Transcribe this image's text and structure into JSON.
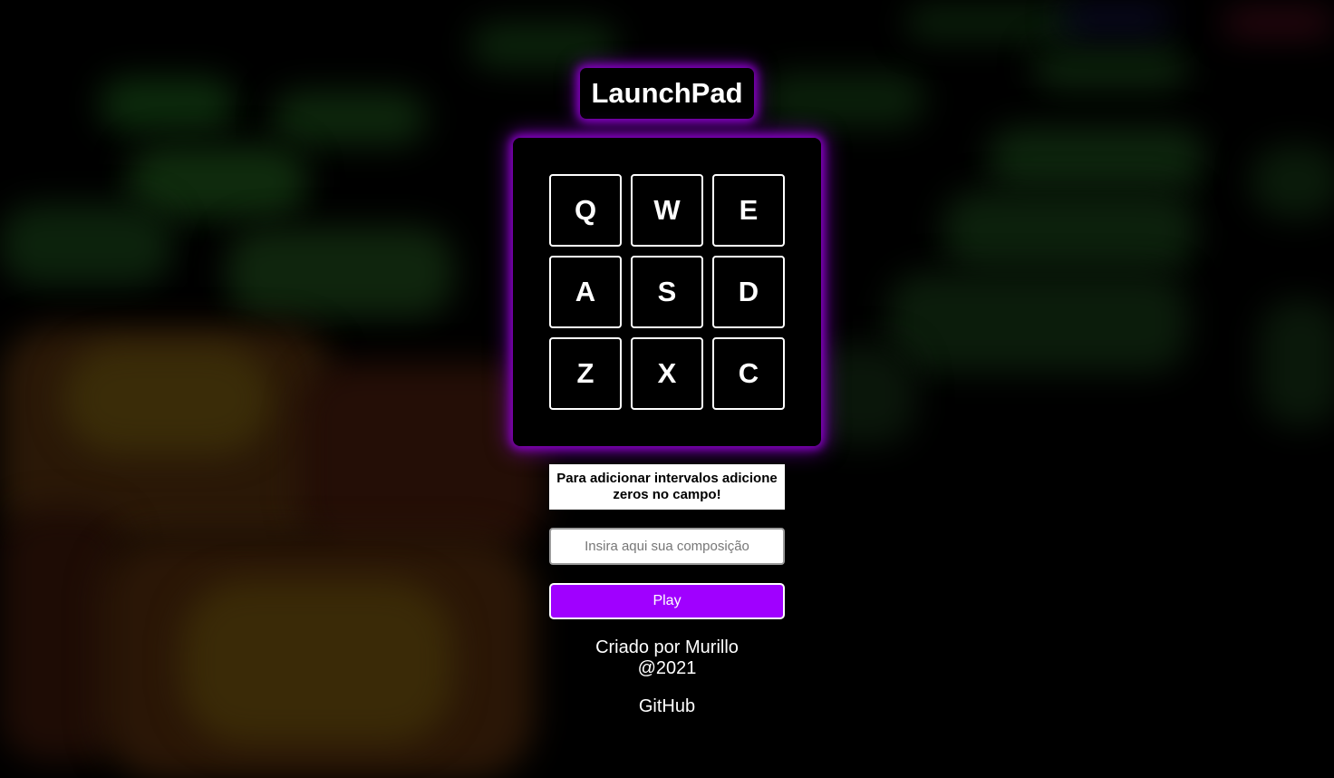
{
  "app": {
    "title": "LaunchPad"
  },
  "pad": {
    "keys": [
      "Q",
      "W",
      "E",
      "A",
      "S",
      "D",
      "Z",
      "X",
      "C"
    ]
  },
  "hint": {
    "text": "Para adicionar intervalos adicione zeros no campo!"
  },
  "composition": {
    "value": "",
    "placeholder": "Insira aqui sua composição"
  },
  "play": {
    "label": "Play"
  },
  "footer": {
    "credit_line1": "Criado por Murillo",
    "credit_line2": "@2021",
    "github_label": "GitHub"
  },
  "colors": {
    "accent": "#a000ff",
    "glow": "#8a00c9",
    "background": "#000000",
    "key_border": "#ffffff"
  }
}
